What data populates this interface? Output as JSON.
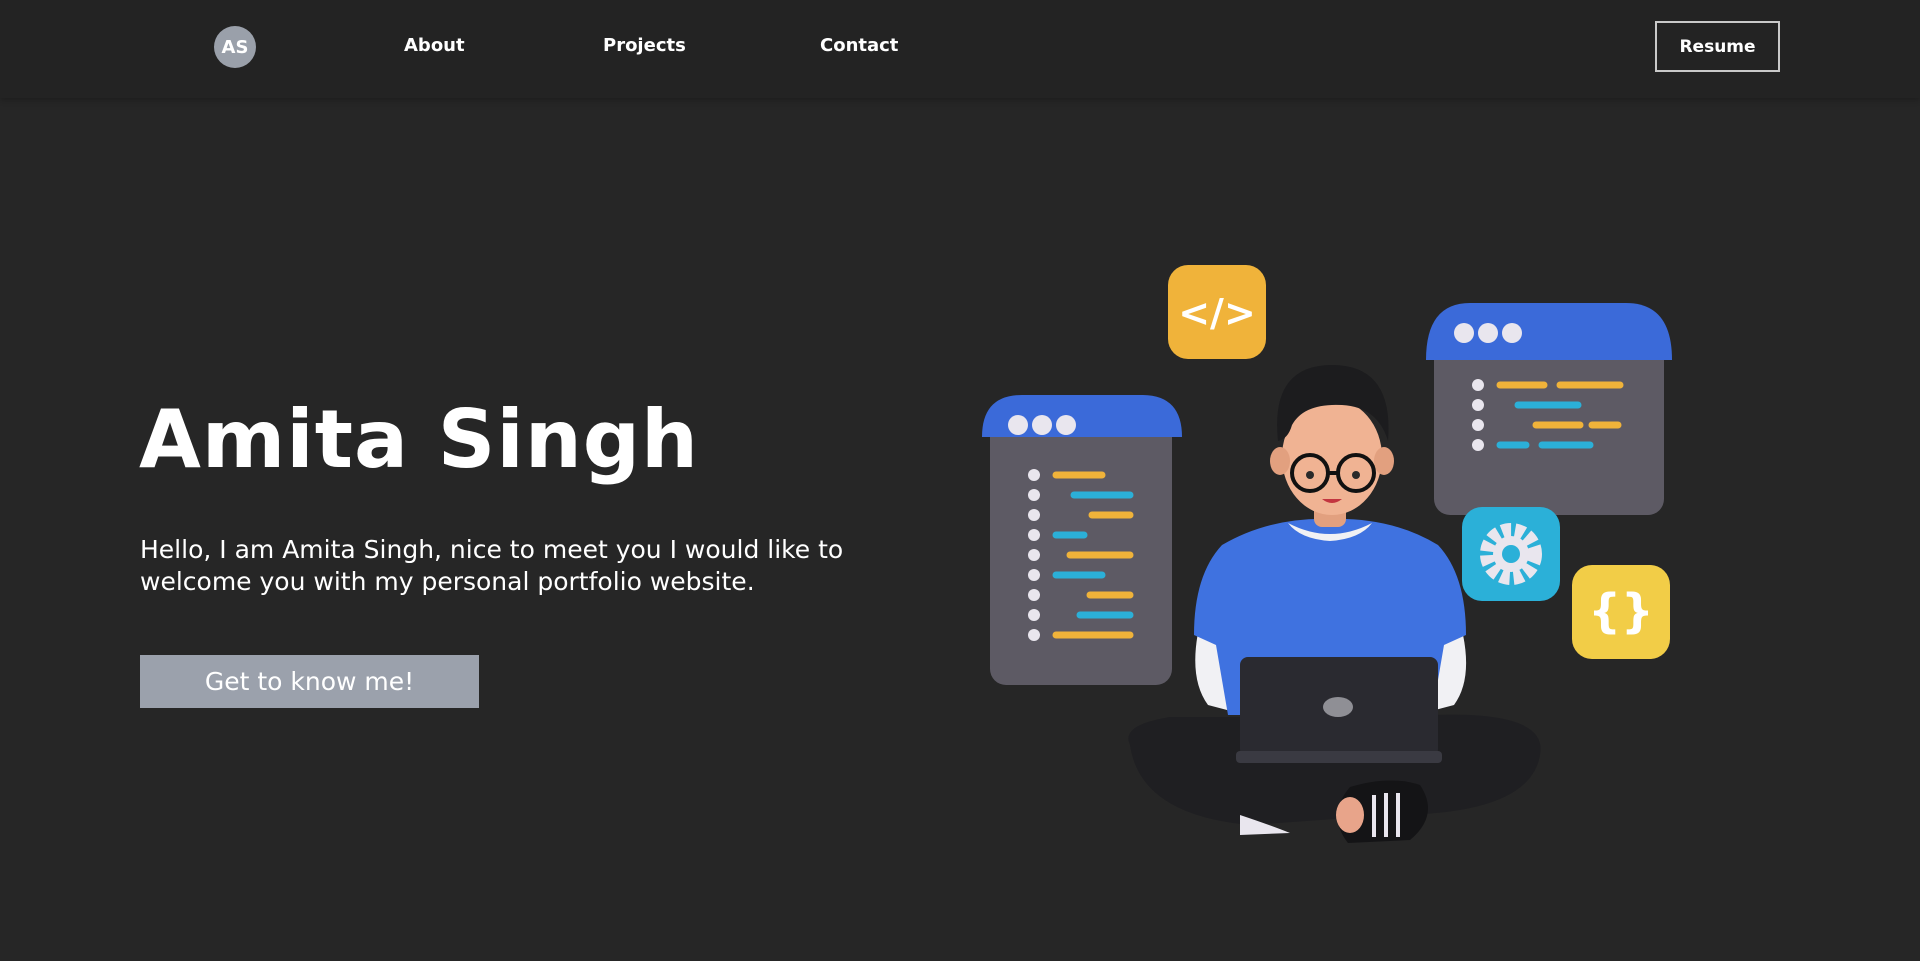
{
  "nav": {
    "logo_text": "AS",
    "links": [
      {
        "label": "About"
      },
      {
        "label": "Projects"
      },
      {
        "label": "Contact"
      }
    ],
    "resume_label": "Resume"
  },
  "hero": {
    "name": "Amita Singh",
    "intro": "Hello, I am Amita Singh, nice to meet you I would like to welcome you with my personal portfolio website.",
    "cta_label": "Get to know me!"
  },
  "illustration": {
    "code_tag_text": "</>",
    "braces_text": "{}"
  },
  "colors": {
    "background": "#262626",
    "navbar": "#232323",
    "cta_button": "#9ba1ac",
    "logo_circle": "#9aa0aa",
    "window_header_blue": "#3b6ad9",
    "window_body": "#5d5a64",
    "code_orange": "#f0b33a",
    "code_blue": "#2bb0d8",
    "shirt_blue": "#3f72e0"
  }
}
